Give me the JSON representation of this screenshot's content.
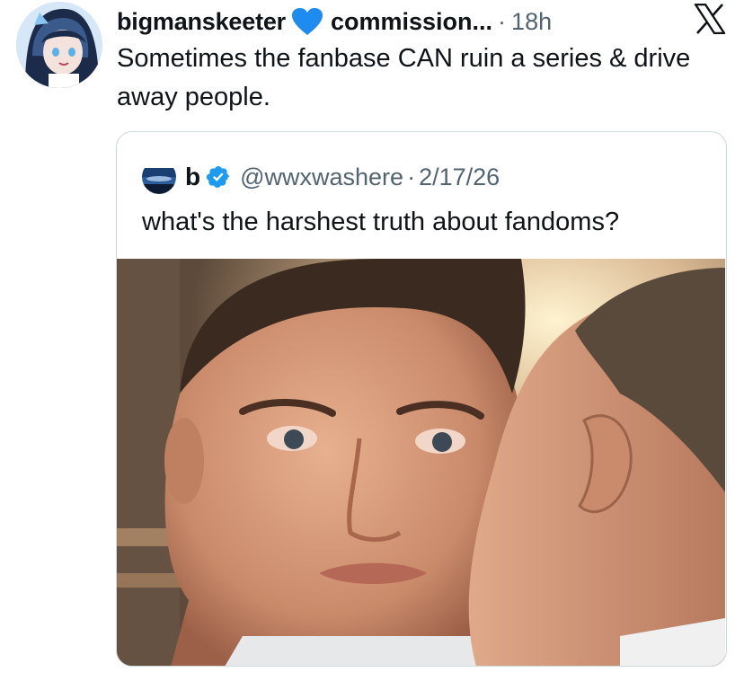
{
  "tweet": {
    "display_name": "bigmanskeeter",
    "affiliation_name": "commission...",
    "separator": "·",
    "time": "18h",
    "text": "Sometimes the fanbase CAN ruin a series & drive away people.",
    "heart_icon": "blue-heart-emoji",
    "heart_color": "#1d8bf0"
  },
  "quoted_tweet": {
    "display_name": "b",
    "handle": "@wwxwashere",
    "separator": "·",
    "date": "2/17/26",
    "text": "what's the harshest truth about fandoms?",
    "verified_icon": "verified-badge-icon",
    "verified_color": "#1d9bf0"
  },
  "branding": {
    "logo": "x-logo-icon"
  }
}
